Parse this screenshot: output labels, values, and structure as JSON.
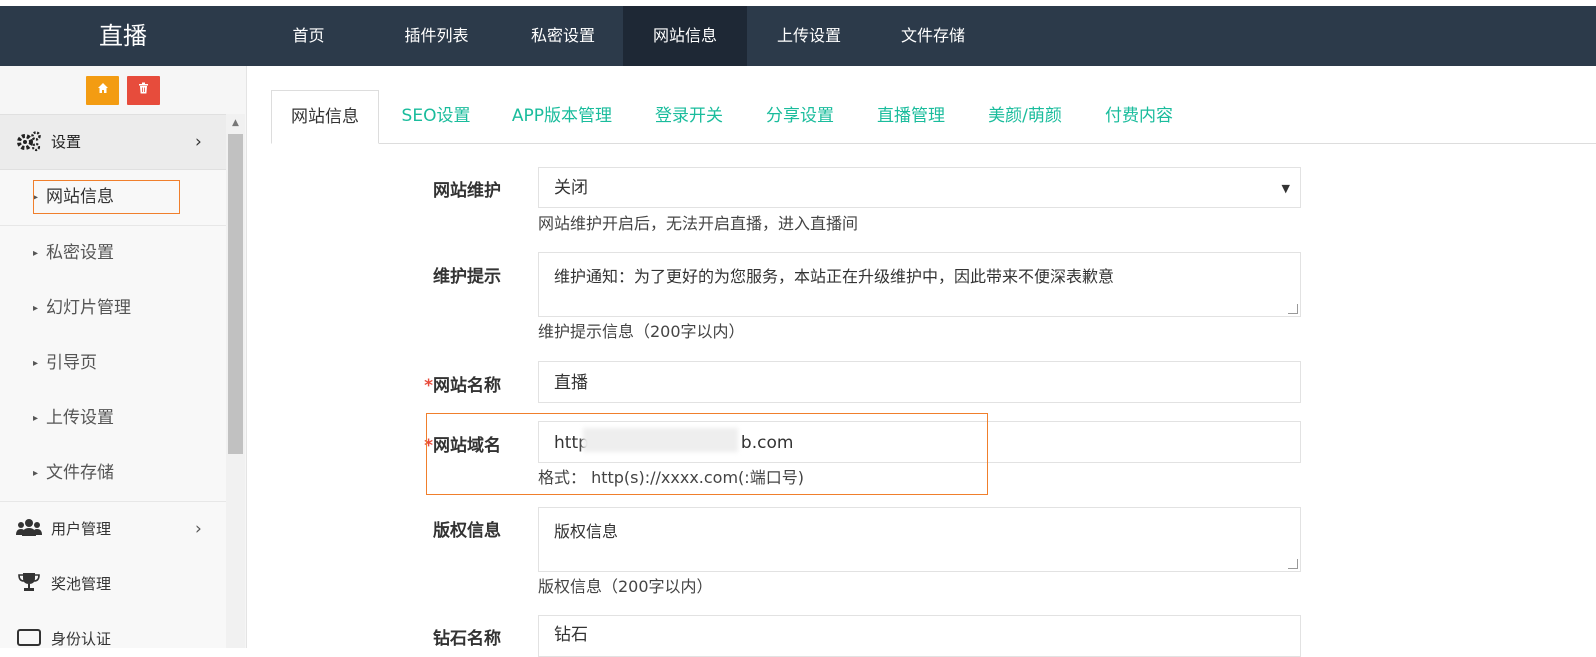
{
  "brand": "直播",
  "topnav": [
    {
      "label": "首页"
    },
    {
      "label": "插件列表"
    },
    {
      "label": "私密设置"
    },
    {
      "label": "网站信息",
      "active": true
    },
    {
      "label": "上传设置"
    },
    {
      "label": "文件存储"
    }
  ],
  "sidebar": {
    "tools": {
      "home_icon": "home-icon",
      "delete_icon": "trash-icon",
      "colors": {
        "home": "#f39c12",
        "delete": "#e74c3c"
      }
    },
    "settings_group": {
      "label": "设置",
      "icon": "gears-icon"
    },
    "items": [
      {
        "label": "网站信息",
        "active": true
      },
      {
        "label": "私密设置"
      },
      {
        "label": "幻灯片管理"
      },
      {
        "label": "引导页"
      },
      {
        "label": "上传设置"
      },
      {
        "label": "文件存储"
      }
    ],
    "user_group": {
      "label": "用户管理",
      "icon": "users-icon"
    },
    "pool_group": {
      "label": "奖池管理",
      "icon": "trophy-icon"
    },
    "auth_group": {
      "label": "身份认证",
      "icon": "id-card-icon"
    }
  },
  "tabs": [
    {
      "label": "网站信息",
      "active": true
    },
    {
      "label": "SEO设置"
    },
    {
      "label": "APP版本管理"
    },
    {
      "label": "登录开关"
    },
    {
      "label": "分享设置"
    },
    {
      "label": "直播管理"
    },
    {
      "label": "美颜/萌颜"
    },
    {
      "label": "付费内容"
    }
  ],
  "form": {
    "maintenance": {
      "label": "网站维护",
      "value": "关闭",
      "hint": "网站维护开启后，无法开启直播，进入直播间"
    },
    "maintenance_tip": {
      "label": "维护提示",
      "value": "维护通知：为了更好的为您服务，本站正在升级维护中，因此带来不便深表歉意",
      "hint": "维护提示信息（200字以内）"
    },
    "site_name": {
      "label": "网站名称",
      "required": "*",
      "value": "直播"
    },
    "site_domain": {
      "label": "网站域名",
      "required": "*",
      "value_prefix": "http",
      "value_suffix": "b.com",
      "hint": "格式： http(s)://xxxx.com(:端口号)"
    },
    "copyright": {
      "label": "版权信息",
      "value": "版权信息",
      "hint": "版权信息（200字以内）"
    },
    "diamond_name": {
      "label": "钻石名称",
      "value": "钻石"
    }
  },
  "colors": {
    "topbar": "#2c3a4a",
    "tab_link": "#1abc9c",
    "highlight": "#f07f2c",
    "required": "#e74c3c"
  }
}
